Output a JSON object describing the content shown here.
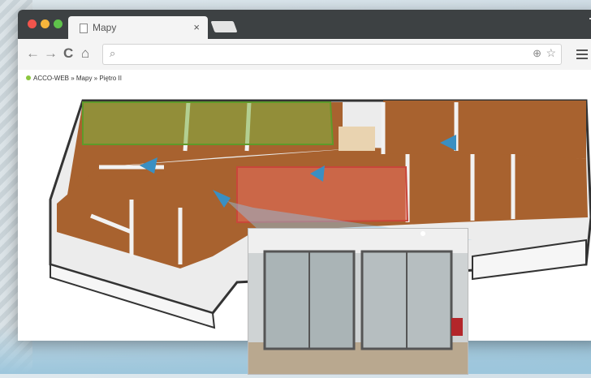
{
  "browser": {
    "tab_title": "Mapy",
    "tab_close": "×",
    "nav_back": "←",
    "nav_forward": "→",
    "nav_reload": "C",
    "nav_home": "⌂",
    "address_value": "",
    "search_icon": "⌕",
    "zoom_icon": "⊕",
    "star_icon": "☆"
  },
  "breadcrumb": {
    "text": "ACCO-WEB » Mapy » Piętro II"
  },
  "colors": {
    "titlebar": "#3d4143",
    "floor": "#a8622f",
    "zone_green": "#7fb241",
    "zone_red": "#e36a5a",
    "camera": "#3a8fc2"
  },
  "icons": {
    "tab": "document-icon",
    "camera": "security-camera-icon",
    "menu": "hamburger-menu-icon"
  }
}
